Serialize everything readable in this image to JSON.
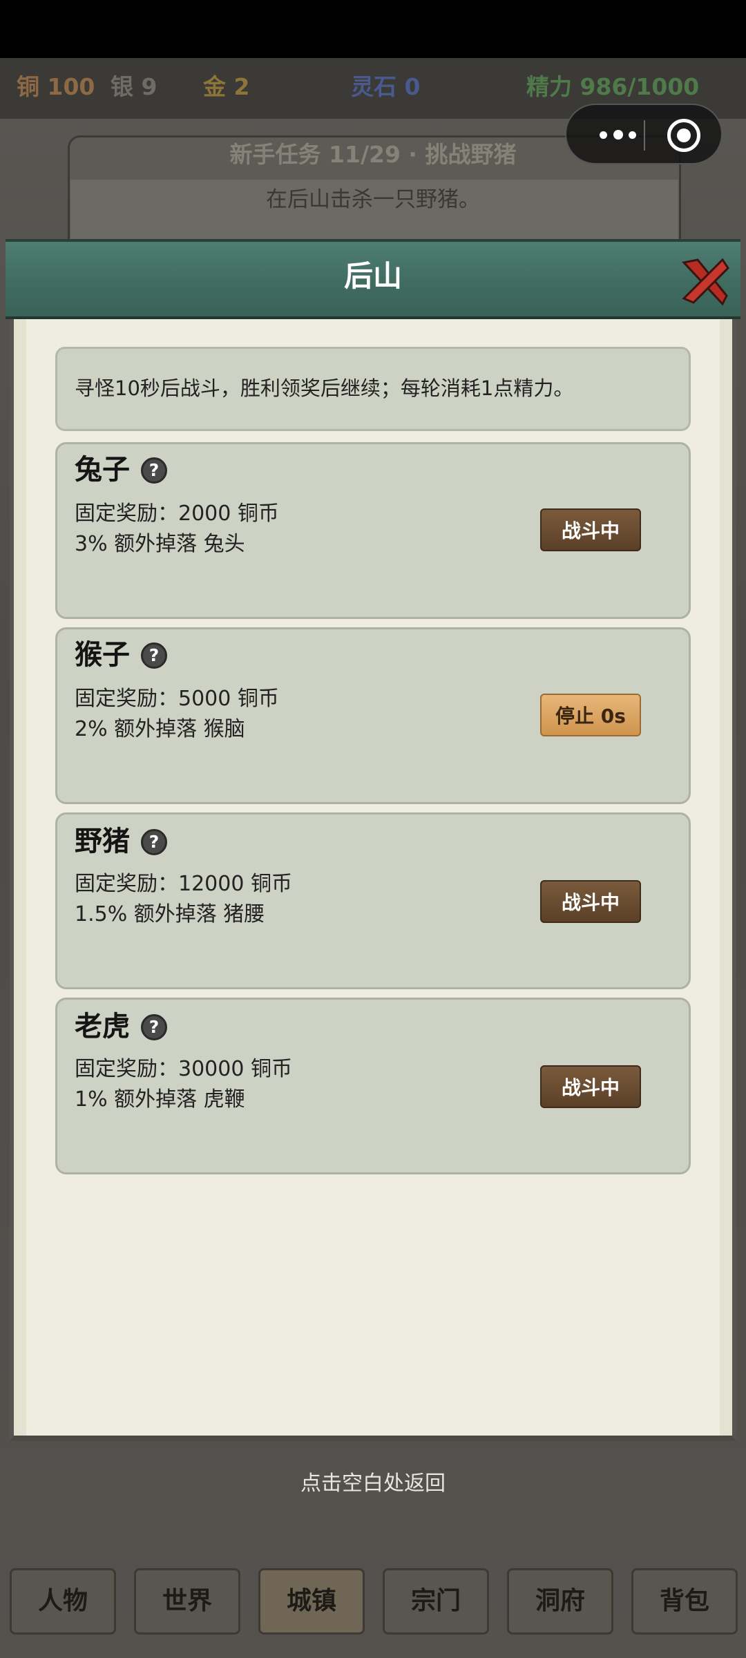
{
  "resources": {
    "copper": "铜 100",
    "silver": "银 9",
    "gold": "金 2",
    "spirit_stone": "灵石 0",
    "energy": "精力 986/1000"
  },
  "quest": {
    "title": "新手任务 11/29 · 挑战野猪",
    "description": "在后山击杀一只野猪。"
  },
  "modal": {
    "title": "后山",
    "info": "寻怪10秒后战斗，胜利领奖后继续；每轮消耗1点精力。"
  },
  "monsters": [
    {
      "name": "兔子",
      "reward": "固定奖励：2000 铜币",
      "drop": "3% 额外掉落 兔头",
      "button": "战斗中"
    },
    {
      "name": "猴子",
      "reward": "固定奖励：5000 铜币",
      "drop": "2% 额外掉落 猴脑",
      "button": "停止 0s"
    },
    {
      "name": "野猪",
      "reward": "固定奖励：12000 铜币",
      "drop": "1.5% 额外掉落 猪腰",
      "button": "战斗中"
    },
    {
      "name": "老虎",
      "reward": "固定奖励：30000 铜币",
      "drop": "1% 额外掉落 虎鞭",
      "button": "战斗中"
    }
  ],
  "help_icon_glyph": "?",
  "back_hint": "点击空白处返回",
  "nav": [
    "人物",
    "世界",
    "城镇",
    "宗门",
    "洞府",
    "背包"
  ],
  "colors": {
    "header_teal": "#3f6b5f",
    "parchment": "#eeede0",
    "card": "#cdd2c4",
    "button_brown": "#5b4027",
    "button_stop": "#cf954e"
  },
  "icons": {
    "menu": "more-dots-icon",
    "close_mini": "target-circle-icon",
    "close_modal": "close-x-icon",
    "help": "help-question-icon"
  }
}
